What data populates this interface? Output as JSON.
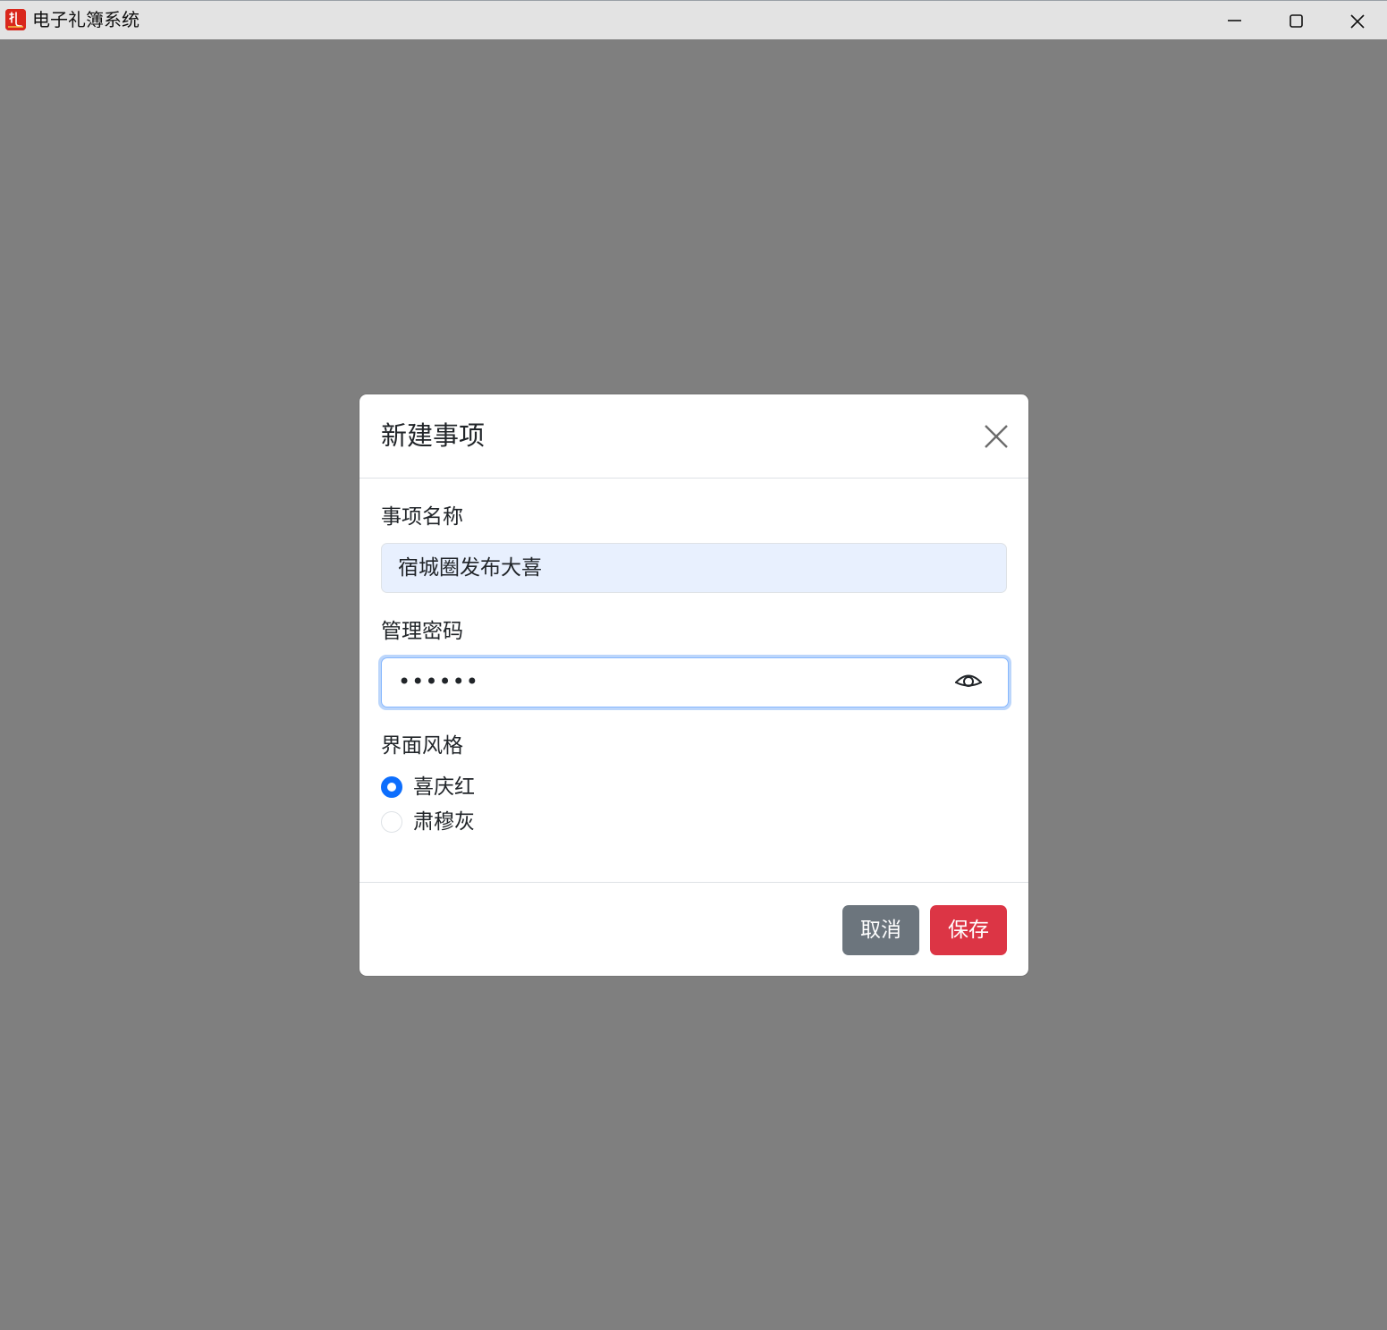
{
  "window": {
    "title": "电子礼簿系统",
    "icon": "app-logo-icon",
    "controls": [
      "minimize-icon",
      "maximize-icon",
      "close-icon"
    ]
  },
  "modal": {
    "title": "新建事项",
    "close_icon": "close-icon",
    "fields": {
      "name": {
        "label": "事项名称",
        "value": "宿城圈发布大喜"
      },
      "password": {
        "label": "管理密码",
        "value": "••••••",
        "toggle_icon": "eye-icon"
      },
      "theme": {
        "label": "界面风格",
        "options": [
          {
            "label": "喜庆红",
            "selected": true
          },
          {
            "label": "肃穆灰",
            "selected": false
          }
        ]
      }
    },
    "footer": {
      "cancel_label": "取消",
      "save_label": "保存"
    }
  },
  "colors": {
    "overlay": "#7f7f7f",
    "primary": "#0d6efd",
    "cancel": "#6c757d",
    "save": "#dc3545",
    "app_icon": "#d9271c"
  }
}
